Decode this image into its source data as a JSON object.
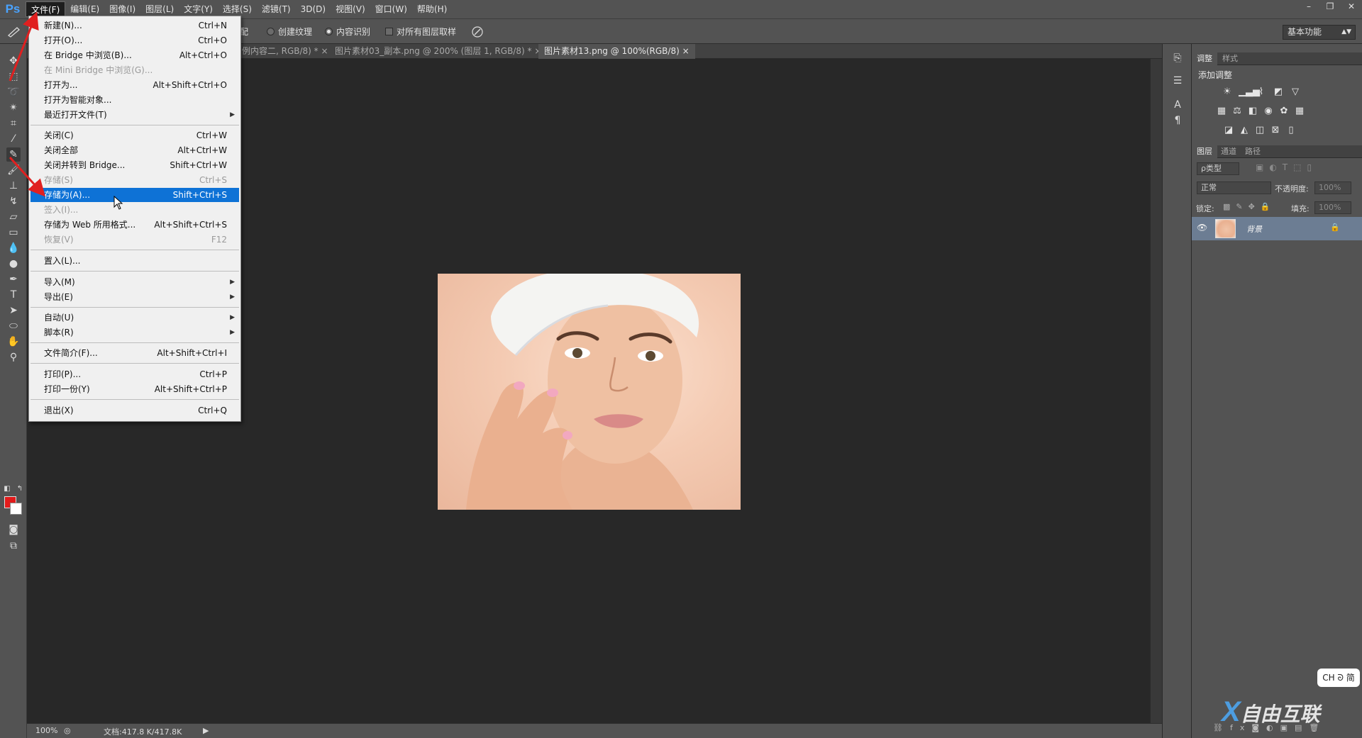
{
  "app": {
    "logo": "Ps",
    "menu": [
      "文件(F)",
      "编辑(E)",
      "图像(I)",
      "图层(L)",
      "文字(Y)",
      "选择(S)",
      "滤镜(T)",
      "3D(D)",
      "视图(V)",
      "窗口(W)",
      "帮助(H)"
    ],
    "active_menu_index": 0,
    "window_controls": [
      "–",
      "❐",
      "✕"
    ]
  },
  "options_bar": {
    "partial_label": "配",
    "create_texture": "创建纹理",
    "content_aware": "内容识别",
    "sample_all_layers": "对所有图层取样",
    "workspace": "基本功能"
  },
  "doc_tabs": [
    {
      "label": "例内容二, RGB/8) *",
      "close": "×"
    },
    {
      "label": "图片素材03_副本.png @ 200% (图层 1, RGB/8) *",
      "close": "×"
    },
    {
      "label": "图片素材13.png @ 100%(RGB/8)",
      "close": "×"
    }
  ],
  "file_menu": {
    "items": [
      {
        "label": "新建(N)...",
        "shortcut": "Ctrl+N"
      },
      {
        "label": "打开(O)...",
        "shortcut": "Ctrl+O"
      },
      {
        "label": "在 Bridge 中浏览(B)...",
        "shortcut": "Alt+Ctrl+O"
      },
      {
        "label": "在 Mini Bridge 中浏览(G)...",
        "shortcut": "",
        "disabled": true
      },
      {
        "label": "打开为...",
        "shortcut": "Alt+Shift+Ctrl+O"
      },
      {
        "label": "打开为智能对象...",
        "shortcut": ""
      },
      {
        "label": "最近打开文件(T)",
        "shortcut": "",
        "submenu": true
      },
      {
        "label": "关闭(C)",
        "shortcut": "Ctrl+W"
      },
      {
        "label": "关闭全部",
        "shortcut": "Alt+Ctrl+W"
      },
      {
        "label": "关闭并转到 Bridge...",
        "shortcut": "Shift+Ctrl+W"
      },
      {
        "label": "存储(S)",
        "shortcut": "Ctrl+S",
        "disabled": true
      },
      {
        "label": "存储为(A)...",
        "shortcut": "Shift+Ctrl+S",
        "highlighted": true
      },
      {
        "label": "签入(I)...",
        "shortcut": "",
        "disabled": true
      },
      {
        "label": "存储为 Web 所用格式...",
        "shortcut": "Alt+Shift+Ctrl+S"
      },
      {
        "label": "恢复(V)",
        "shortcut": "F12",
        "disabled": true
      },
      {
        "label": "置入(L)...",
        "shortcut": ""
      },
      {
        "label": "导入(M)",
        "shortcut": "",
        "submenu": true
      },
      {
        "label": "导出(E)",
        "shortcut": "",
        "submenu": true
      },
      {
        "label": "自动(U)",
        "shortcut": "",
        "submenu": true
      },
      {
        "label": "脚本(R)",
        "shortcut": "",
        "submenu": true
      },
      {
        "label": "文件简介(F)...",
        "shortcut": "Alt+Shift+Ctrl+I"
      },
      {
        "label": "打印(P)...",
        "shortcut": "Ctrl+P"
      },
      {
        "label": "打印一份(Y)",
        "shortcut": "Alt+Shift+Ctrl+P"
      },
      {
        "label": "退出(X)",
        "shortcut": "Ctrl+Q"
      }
    ]
  },
  "status_bar": {
    "zoom": "100%",
    "doc_info": "文档:417.8 K/417.8K"
  },
  "adjustments_panel": {
    "tabs": [
      "调整",
      "样式"
    ],
    "title": "添加调整"
  },
  "layers_panel": {
    "tabs": [
      "图层",
      "通道",
      "路径"
    ],
    "filter_kind": "ρ类型",
    "blend_mode": "正常",
    "opacity_label": "不透明度:",
    "opacity_value": "100%",
    "lock_label": "锁定:",
    "fill_label": "填充:",
    "fill_value": "100%",
    "layer_name": "背景"
  },
  "ime_badge": "CH ᘐ 简",
  "watermark": "自由互联",
  "colors": {
    "menu_highlight": "#0e72d6",
    "foreground": "#e21b1b",
    "background": "#ffffff",
    "annotation_arrow": "#e02020"
  }
}
